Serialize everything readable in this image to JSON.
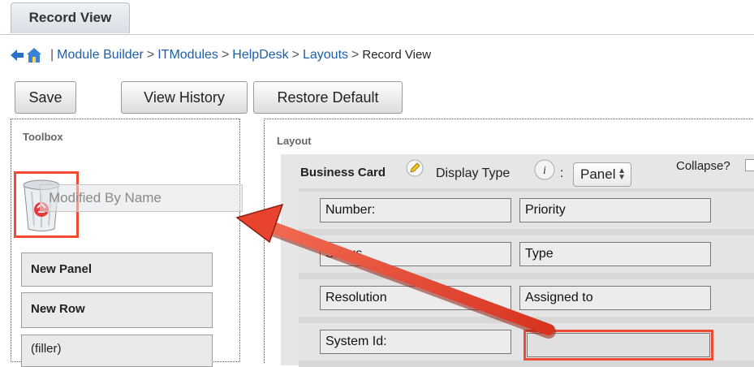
{
  "tab": {
    "label": "Record View"
  },
  "breadcrumb": {
    "items": [
      "Module Builder",
      "ITModules",
      "HelpDesk",
      "Layouts"
    ],
    "separator": ">",
    "leading_separator": "|",
    "current": "Record View"
  },
  "toolbar": {
    "save": "Save",
    "view_history": "View History",
    "restore_default": "Restore Default"
  },
  "toolbox": {
    "title": "Toolbox",
    "dragging_field": "Modified By Name",
    "items": [
      "New Panel",
      "New Row",
      "(filler)"
    ]
  },
  "layout": {
    "title": "Layout",
    "panel_name": "Business Card",
    "display_type_label": "Display Type",
    "colon": ":",
    "display_type_value": "Panel",
    "collapse_label": "Collapse?",
    "rows": [
      [
        "Number:",
        "Priority"
      ],
      [
        "Status",
        "Type"
      ],
      [
        "Resolution",
        "Assigned to"
      ],
      [
        "System Id:",
        ""
      ]
    ]
  },
  "colors": {
    "highlight": "#f04a33",
    "link": "#1d5fa8",
    "arrow": "#e8432f"
  },
  "icons": [
    "back-arrow-icon",
    "home-icon",
    "trash-icon",
    "pencil-icon",
    "info-icon",
    "stepper-icon"
  ]
}
